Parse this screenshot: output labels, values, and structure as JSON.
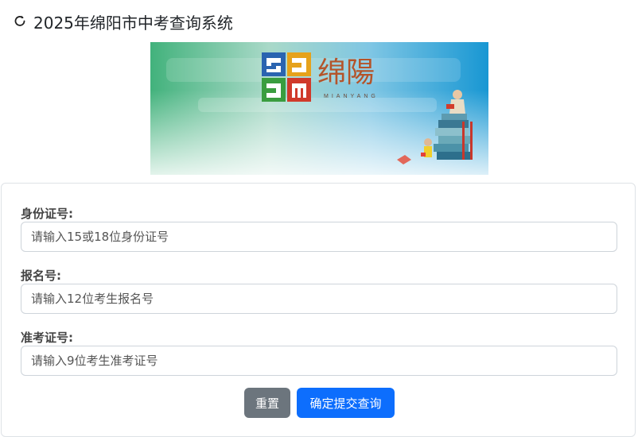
{
  "header": {
    "icon": "refresh-icon",
    "title": "2025年绵阳市中考查询系统"
  },
  "banner": {
    "logo_text": "绵陽",
    "logo_pinyin": "MIANYANG"
  },
  "form": {
    "id_card": {
      "label": "身份证号:",
      "placeholder": "请输入15或18位身份证号"
    },
    "registration": {
      "label": "报名号:",
      "placeholder": "请输入12位考生报名号"
    },
    "admission": {
      "label": "准考证号:",
      "placeholder": "请输入9位考生准考证号"
    },
    "reset_label": "重置",
    "submit_label": "确定提交查询"
  },
  "colors": {
    "reset": "#6c757d",
    "submit": "#0d6efd",
    "banner_left": "#3fb07a",
    "banner_right": "#1a9ad6"
  }
}
